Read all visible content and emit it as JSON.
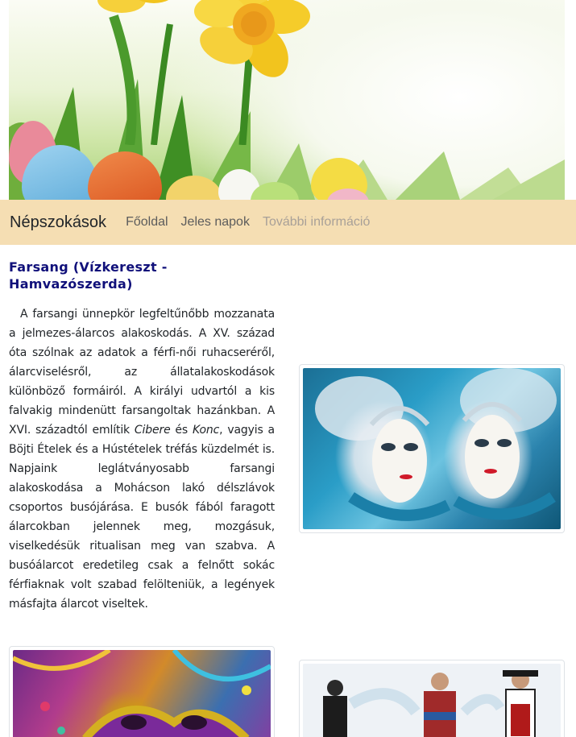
{
  "navbar": {
    "brand": "Népszokások",
    "links": [
      "Főoldal",
      "Jeles napok",
      "További információ"
    ]
  },
  "article": {
    "title": "Farsang (Vízkereszt - Hamvazószerda)",
    "paragraph_part1": "A farsangi ünnepkör legfeltűnőbb mozzanata a jelmezes-álarcos alakoskodás. A XV. század óta szólnak az adatok a férfi-női ruhacseréről, álarcviselésről, az állatalakoskodások különböző formáiról. A királyi udvartól a kis falvakig mindenütt farsangoltak hazánkban. A XVI. századtól említik ",
    "paragraph_italic1": "Cibere",
    "paragraph_part2": " és ",
    "paragraph_italic2": "Konc",
    "paragraph_part3": ", vagyis a Böjti Ételek és a Hústételek tréfás küzdelmét is. Napjaink leglátványosabb farsangi alakoskodása a Mohácson lakó délszlávok csoportos busójárása. E busók fából faragott álarcokban jelennek meg, mozgásuk, viselkedésük ritualisan meg van szabva. A busóálarcot eredetileg csak a felnőtt sokác férfiaknak volt szabad felölteniük, a legények másfajta álarcot viseltek."
  },
  "images": {
    "hero": "daffodils-easter-eggs",
    "venice": "venetian-masks",
    "carnival": "carnival-mask",
    "dance": "folk-dancers-water"
  }
}
